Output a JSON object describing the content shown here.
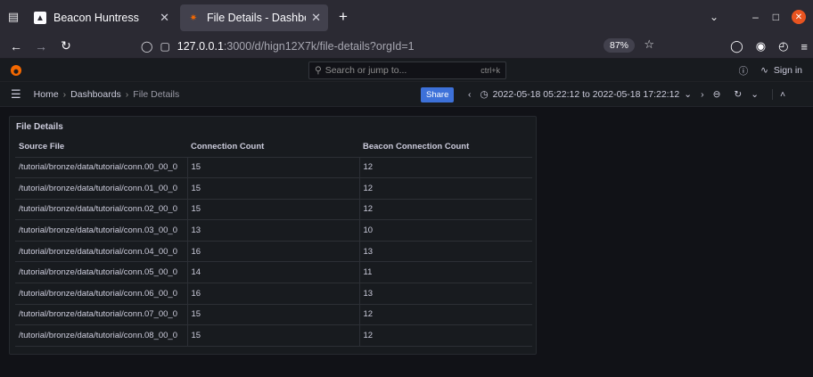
{
  "browser": {
    "tabs": [
      {
        "title": "Beacon Huntress",
        "active": false
      },
      {
        "title": "File Details - Dashboards",
        "active": true
      }
    ],
    "url_host": "127.0.0.1",
    "url_path": ":3000/d/hign12X7k/file-details?orgId=1",
    "zoom": "87%"
  },
  "grafana": {
    "search_placeholder": "Search or jump to...",
    "search_shortcut": "ctrl+k",
    "signin": "Sign in",
    "breadcrumb": [
      "Home",
      "Dashboards",
      "File Details"
    ],
    "share_label": "Share",
    "time_range": "2022-05-18 05:22:12 to 2022-05-18 17:22:12"
  },
  "panel": {
    "title": "File Details",
    "columns": [
      "Source File",
      "Connection Count",
      "Beacon Connection Count"
    ],
    "rows": [
      [
        "/tutorial/bronze/data/tutorial/conn.00_00_0",
        "15",
        "12"
      ],
      [
        "/tutorial/bronze/data/tutorial/conn.01_00_0",
        "15",
        "12"
      ],
      [
        "/tutorial/bronze/data/tutorial/conn.02_00_0",
        "15",
        "12"
      ],
      [
        "/tutorial/bronze/data/tutorial/conn.03_00_0",
        "13",
        "10"
      ],
      [
        "/tutorial/bronze/data/tutorial/conn.04_00_0",
        "16",
        "13"
      ],
      [
        "/tutorial/bronze/data/tutorial/conn.05_00_0",
        "14",
        "11"
      ],
      [
        "/tutorial/bronze/data/tutorial/conn.06_00_0",
        "16",
        "13"
      ],
      [
        "/tutorial/bronze/data/tutorial/conn.07_00_0",
        "15",
        "12"
      ],
      [
        "/tutorial/bronze/data/tutorial/conn.08_00_0",
        "15",
        "12"
      ]
    ]
  },
  "colors": {
    "accent": "#3d71d9",
    "grafana_logo": "#f46800",
    "close": "#e95420"
  }
}
